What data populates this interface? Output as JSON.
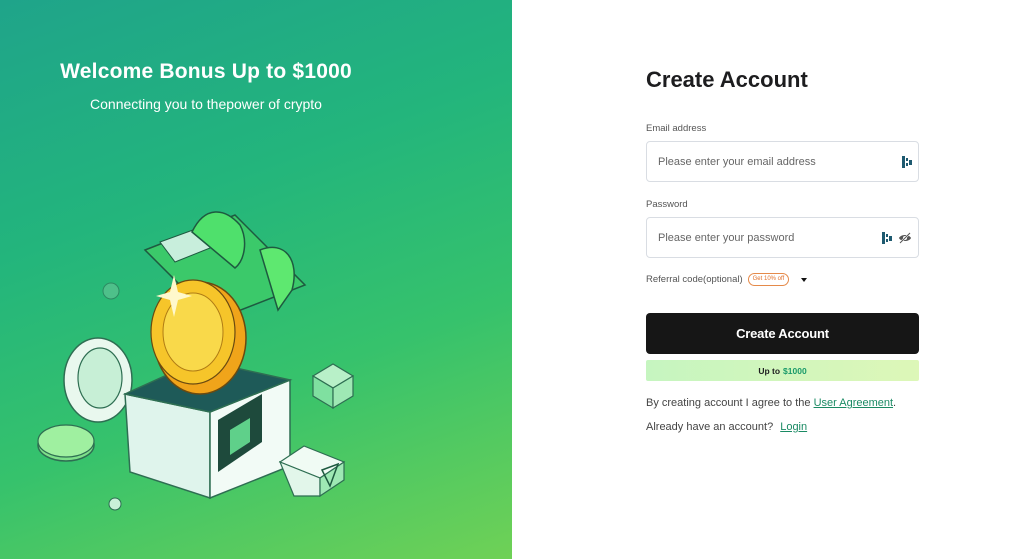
{
  "hero": {
    "title": "Welcome Bonus Up to $1000",
    "subtitle": "Connecting you to thepower of crypto",
    "illustration_icon": "gift-box-coin-illustration"
  },
  "form": {
    "title": "Create Account",
    "email": {
      "label": "Email address",
      "placeholder": "Please enter your email address",
      "value": "",
      "icon": "password-manager-icon"
    },
    "password": {
      "label": "Password",
      "placeholder": "Please enter your password",
      "value": "",
      "icons": [
        "password-manager-icon",
        "eye-off-icon"
      ]
    },
    "referral": {
      "label": "Referral code(optional)",
      "badge": "Get 10% off",
      "icon": "caret-down-icon"
    },
    "submit_label": "Create Account",
    "promo": {
      "prefix": "Up to",
      "amount": "$1000"
    },
    "agreement": {
      "text": "By creating account I agree to the",
      "link": "User Agreement",
      "suffix": "."
    },
    "login": {
      "text": "Already have an account?",
      "link": "Login"
    }
  },
  "colors": {
    "accent": "#1a8a63",
    "button": "#161616",
    "hero_gradient_start": "#1fa48a",
    "hero_gradient_end": "#6fd156",
    "badge": "#e0702a"
  }
}
